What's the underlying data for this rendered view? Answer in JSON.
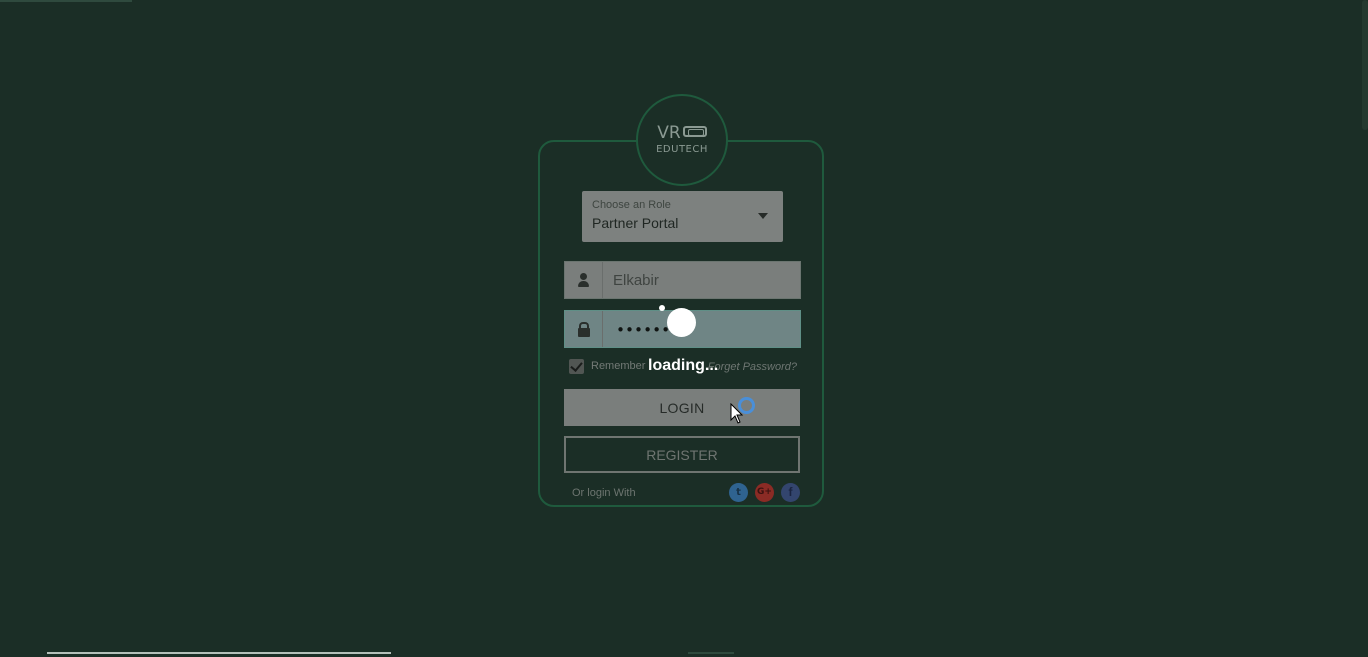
{
  "logo": {
    "line1": "VR",
    "line2": "EDUTECH"
  },
  "role_select": {
    "label": "Choose an Role",
    "value": "Partner Portal"
  },
  "username": {
    "placeholder": "Elkabir"
  },
  "password": {
    "masked_value": "••••••••"
  },
  "remember": {
    "label": "Remember",
    "checked": true
  },
  "forgot_password": "Forget Password?",
  "loading": "loading...",
  "buttons": {
    "login": "LOGIN",
    "register": "REGISTER"
  },
  "social": {
    "label": "Or login With",
    "twitter_glyph": "t",
    "google_glyph": "G+",
    "facebook_glyph": "f",
    "icons": [
      "twitter-icon",
      "google-plus-icon",
      "facebook-icon"
    ]
  },
  "colors": {
    "background": "#1b2e26",
    "card_border": "#1f5a3d",
    "spinner": "#4a8fd8"
  }
}
